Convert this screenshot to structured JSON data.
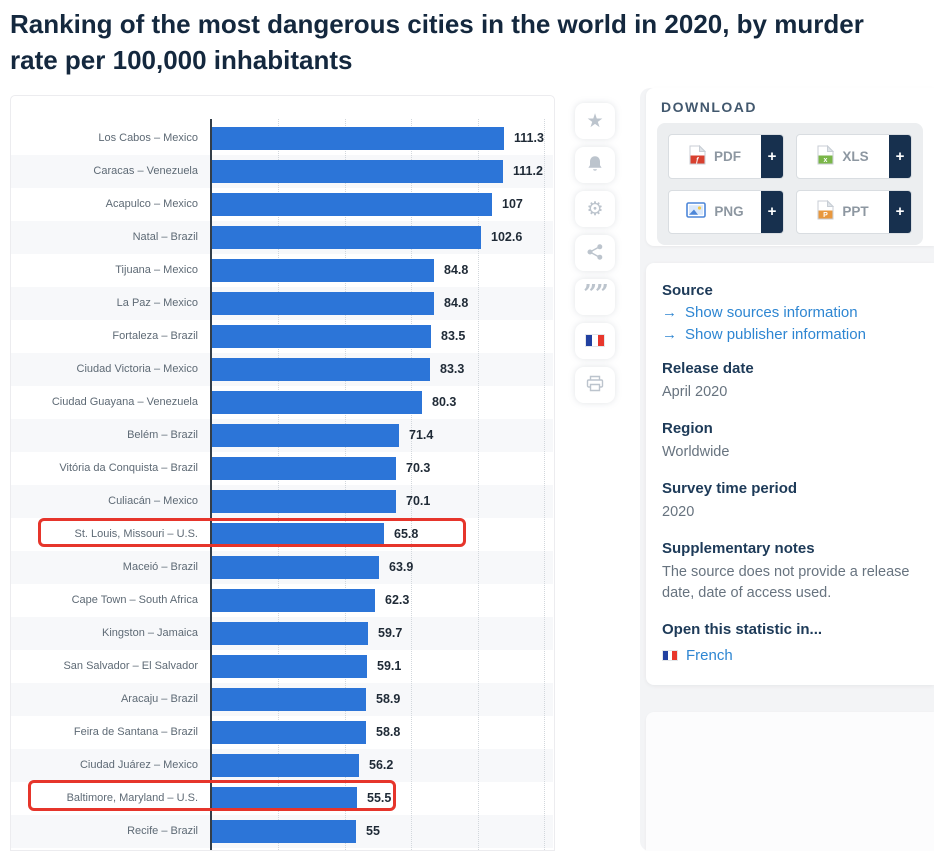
{
  "title": "Ranking of the most dangerous cities in the world in 2020, by murder rate per 100,000 inhabitants",
  "chart_data": {
    "type": "bar",
    "orientation": "horizontal",
    "title": "Ranking of the most dangerous cities in the world in 2020, by murder rate per 100,000 inhabitants",
    "categories": [
      "Los Cabos – Mexico",
      "Caracas – Venezuela",
      "Acapulco – Mexico",
      "Natal – Brazil",
      "Tijuana – Mexico",
      "La Paz – Mexico",
      "Fortaleza – Brazil",
      "Ciudad Victoria – Mexico",
      "Ciudad Guayana – Venezuela",
      "Belém – Brazil",
      "Vitória da Conquista – Brazil",
      "Culiacán – Mexico",
      "St. Louis, Missouri – U.S.",
      "Maceió – Brazil",
      "Cape Town – South Africa",
      "Kingston – Jamaica",
      "San Salvador – El Salvador",
      "Aracaju – Brazil",
      "Feira de Santana – Brazil",
      "Ciudad Juárez – Mexico",
      "Baltimore, Maryland – U.S.",
      "Recife – Brazil"
    ],
    "values": [
      111.3,
      111.2,
      107,
      102.6,
      84.8,
      84.8,
      83.5,
      83.3,
      80.3,
      71.4,
      70.3,
      70.1,
      65.8,
      63.9,
      62.3,
      59.7,
      59.1,
      58.9,
      58.8,
      56.2,
      55.5,
      55
    ],
    "xlim": [
      0,
      125
    ],
    "grid": true,
    "bar_color": "#2c75d8",
    "highlighted_indices": [
      12,
      20
    ],
    "highlight_box_color": "#e6352b"
  },
  "action_rail": {
    "items": [
      {
        "name": "favorite",
        "icon": "star-icon"
      },
      {
        "name": "notifications",
        "icon": "bell-icon"
      },
      {
        "name": "settings",
        "icon": "gear-icon"
      },
      {
        "name": "share",
        "icon": "share-icon"
      },
      {
        "name": "cite",
        "icon": "quote-icon"
      },
      {
        "name": "french-version",
        "icon": "french-flag-icon"
      },
      {
        "name": "print",
        "icon": "printer-icon"
      }
    ]
  },
  "download": {
    "heading": "DOWNLOAD",
    "plus_label": "+",
    "buttons": [
      {
        "label": "PDF",
        "icon": "pdf-file-icon",
        "accent": "#d8402f"
      },
      {
        "label": "XLS",
        "icon": "xls-file-icon",
        "accent": "#7ab648"
      },
      {
        "label": "PNG",
        "icon": "png-image-icon",
        "accent": "#4d86d8"
      },
      {
        "label": "PPT",
        "icon": "ppt-file-icon",
        "accent": "#e8973d"
      }
    ]
  },
  "details": {
    "source": {
      "heading": "Source",
      "links": [
        "Show sources information",
        "Show publisher information"
      ],
      "arrow": "→"
    },
    "release_date": {
      "heading": "Release date",
      "value": "April 2020"
    },
    "region": {
      "heading": "Region",
      "value": "Worldwide"
    },
    "survey_time_period": {
      "heading": "Survey time period",
      "value": "2020"
    },
    "supplementary_notes": {
      "heading": "Supplementary notes",
      "value": "The source does not provide a release date, date of access used."
    },
    "open_in": {
      "heading": "Open this statistic in...",
      "language": "French"
    }
  }
}
